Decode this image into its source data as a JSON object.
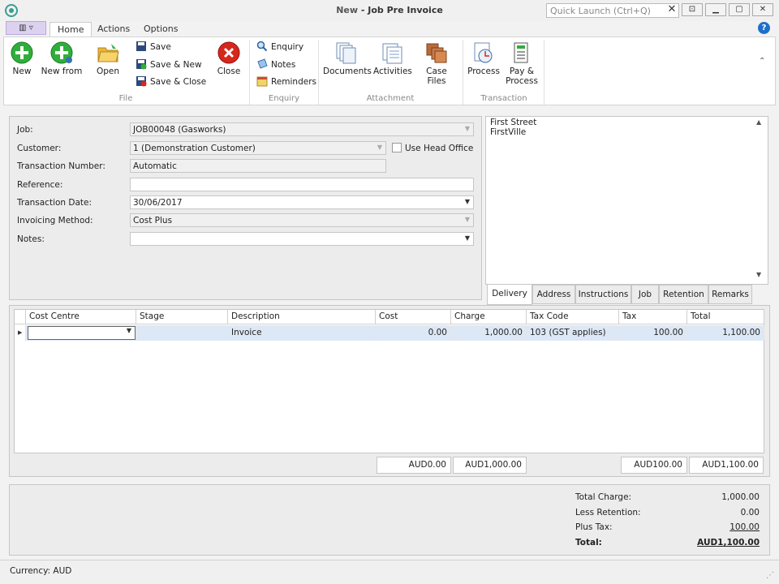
{
  "window": {
    "title_prefix": "New",
    "title_sep": " - ",
    "title": "Job Pre Invoice",
    "quick_launch_placeholder": "Quick Launch (Ctrl+Q)"
  },
  "menu": {
    "tabs": [
      "Home",
      "Actions",
      "Options"
    ],
    "active": "Home"
  },
  "ribbon": {
    "file": {
      "label": "File",
      "new": "New",
      "new_from": "New from",
      "open": "Open",
      "save": "Save",
      "save_new": "Save & New",
      "save_close": "Save & Close",
      "close": "Close"
    },
    "enquiry": {
      "label": "Enquiry",
      "enquiry": "Enquiry",
      "notes": "Notes",
      "reminders": "Reminders"
    },
    "attachment": {
      "label": "Attachment",
      "documents": "Documents",
      "activities": "Activities",
      "case_files": "Case Files"
    },
    "transaction": {
      "label": "Transaction",
      "process": "Process",
      "pay_process_1": "Pay &",
      "pay_process_2": "Process"
    }
  },
  "form": {
    "job": {
      "label": "Job:",
      "value": "JOB00048  (Gasworks)"
    },
    "customer": {
      "label": "Customer:",
      "value": "1  (Demonstration Customer)"
    },
    "use_head_office": "Use Head Office",
    "transaction_number": {
      "label": "Transaction Number:",
      "value": "Automatic"
    },
    "reference": {
      "label": "Reference:",
      "value": ""
    },
    "transaction_date": {
      "label": "Transaction Date:",
      "value": "30/06/2017"
    },
    "invoicing_method": {
      "label": "Invoicing Method:",
      "value": "Cost Plus"
    },
    "notes": {
      "label": "Notes:",
      "value": ""
    }
  },
  "address": {
    "line1": "First Street",
    "line2": "FirstVille"
  },
  "panel_tabs": [
    "Delivery",
    "Address",
    "Instructions",
    "Job",
    "Retention",
    "Remarks"
  ],
  "grid": {
    "columns": [
      "Cost Centre",
      "Stage",
      "Description",
      "Cost",
      "Charge",
      "Tax Code",
      "Tax",
      "Total"
    ],
    "rows": [
      {
        "cost_centre": "",
        "stage": "",
        "description": "Invoice",
        "cost": "0.00",
        "charge": "1,000.00",
        "tax_code": "103  (GST applies)",
        "tax": "100.00",
        "total": "1,100.00"
      }
    ],
    "totals": {
      "cost": "AUD0.00",
      "charge": "AUD1,000.00",
      "tax": "AUD100.00",
      "total": "AUD1,100.00"
    }
  },
  "summary": {
    "total_charge": {
      "label": "Total Charge:",
      "value": "1,000.00"
    },
    "less_retention": {
      "label": "Less Retention:",
      "value": "0.00"
    },
    "plus_tax": {
      "label": "Plus Tax:",
      "value": "100.00"
    },
    "total": {
      "label": "Total:",
      "value": "AUD1,100.00"
    }
  },
  "status": {
    "currency": "Currency: AUD"
  },
  "colors": {
    "accent": "#1f6fc8",
    "selected_row": "#dde8f6",
    "add_green": "#2fae3b",
    "close_red": "#d7261b"
  }
}
